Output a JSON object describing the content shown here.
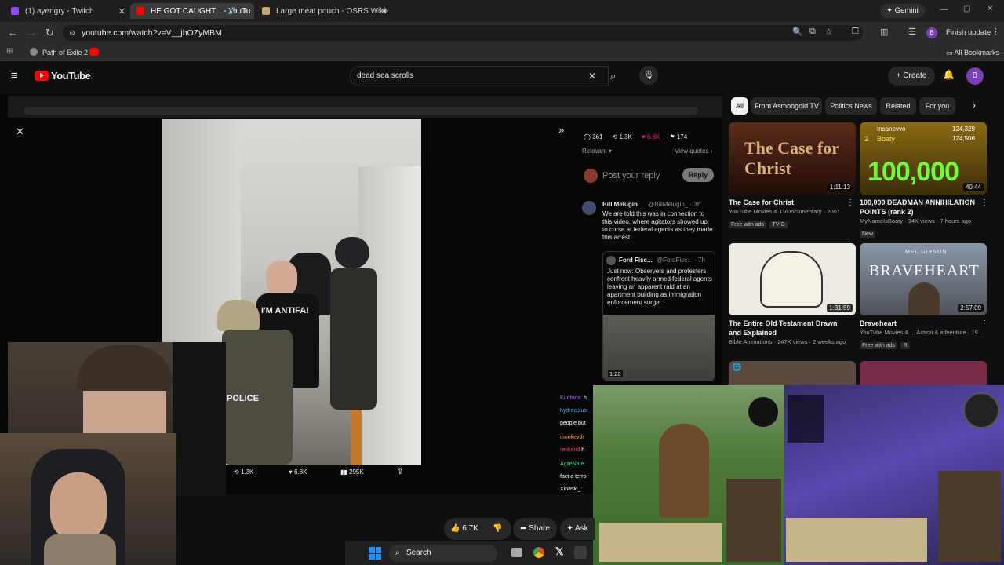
{
  "browser": {
    "tabs": [
      {
        "label": "(1) ayengry - Twitch",
        "color": "#9146ff"
      },
      {
        "label": "HE GOT CAUGHT... - YouTu",
        "color": "#ff0000"
      },
      {
        "label": "Large meat pouch - OSRS Wiki",
        "color": "#c2a878"
      }
    ],
    "gemini_label": "Gemini",
    "url": "youtube.com/watch?v=V__jhOZyMBM",
    "update_label": "Finish update",
    "bookmarks": [
      "Path of Exile 2"
    ],
    "all_bookmarks": "All Bookmarks"
  },
  "youtube": {
    "logo_text": "YouTube",
    "search_value": "dead sea scrolls",
    "create_label": "Create",
    "avatar_letter": "B",
    "actions": {
      "likes": "6.7K",
      "share": "Share",
      "ask": "Ask"
    }
  },
  "xpost": {
    "stats": {
      "replies": "361",
      "reposts": "1.3K",
      "likes": "6.8K",
      "bookmarks": "174"
    },
    "sort": "Relevant",
    "view_quotes": "View quotes",
    "reply_placeholder": "Post your reply",
    "reply_btn": "Reply",
    "author": "Bill Melugin",
    "handle": "@BillMelugin_ · 3h",
    "text": "We are told this was in connection to this video, where agitators showed up to curse at federal agents as they made this arrest.",
    "quote_author": "Ford Fisc...",
    "quote_handle": "@FordFisc... · 7h",
    "quote_text": "Just now: Observers and protesters confront heavily armed federal agents leaving an apparent raid at an apartment building as immigration enforcement surge...",
    "quote_duration": "1:22",
    "bottom_stats": {
      "reposts": "1.3K",
      "likes": "6.8K",
      "views": "295K"
    }
  },
  "photo": {
    "shirt_text": "I'M ANTIFA!",
    "vest_text": "POLICE"
  },
  "chat": {
    "lines": [
      {
        "user": "Kuntrina:",
        "msg": "h",
        "color": "#b05cff"
      },
      {
        "user": "hydreculus:",
        "msg": "",
        "color": "#4aa3ff"
      },
      {
        "user": "",
        "msg": "people but",
        "color": "#ffffff"
      },
      {
        "user": "monkeydr",
        "msg": "",
        "color": "#ff9d2e"
      },
      {
        "user": "renkend",
        "msg": "h",
        "color": "#ff3b3b"
      },
      {
        "user": "AgileNate:",
        "msg": "",
        "color": "#2ed18c"
      },
      {
        "user": "",
        "msg": "fact a terro",
        "color": "#ffffff"
      },
      {
        "user": "Xinaski_:",
        "msg": "",
        "color": "#ffffff"
      }
    ]
  },
  "rail": {
    "chips": [
      "All",
      "From Asmongold TV",
      "Politics News",
      "Related",
      "For you"
    ],
    "videos": [
      {
        "title": "The Case for Christ",
        "channel": "YouTube Movies & TVDocumentary · 2007",
        "badge": "Free with ads",
        "badge2": "TV-G",
        "duration": "1:11:13",
        "thumb_text": "The Case for Christ",
        "thumb_bg": "#3a1c12"
      },
      {
        "title": "100,000 DEADMAN ANNIHILATION POINTS (rank 2)",
        "channel": "MyNameIsBoaty · 34K views · 7 hours ago",
        "badge": "New",
        "badge2": "",
        "duration": "40:44",
        "thumb_text": "100,000",
        "thumb_bg": "#6b5a10"
      },
      {
        "title": "The Entire Old Testament Drawn and Explained",
        "channel": "Bible Animations · 247K views · 2 weeks ago",
        "badge": "",
        "badge2": "",
        "duration": "1:31:59",
        "thumb_text": "",
        "thumb_bg": "#e8e6df"
      },
      {
        "title": "Braveheart",
        "channel": "YouTube Movies & ... Action & adventure · 19...",
        "badge": "Free with ads",
        "badge2": "R",
        "duration": "2:57:09",
        "thumb_text": "BRAVEHEART",
        "thumb_bg": "#6d7a86"
      }
    ],
    "thumb2_overlay": {
      "name1": "Insanevvo",
      "score1": "124,329",
      "name2": "Boaty",
      "score2": "124,506",
      "rank1": "1",
      "rank2": "2"
    },
    "braveheart_top": "MEL GIBSON"
  },
  "taskbar": {
    "search": "Search"
  }
}
